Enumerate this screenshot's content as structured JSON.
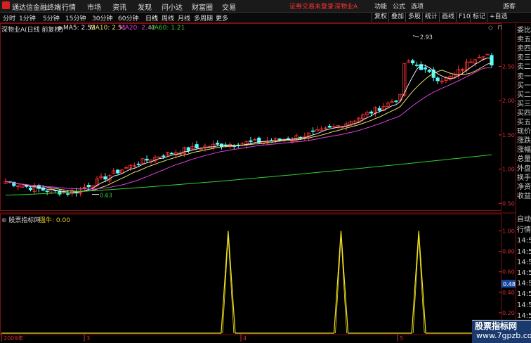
{
  "app": {
    "title": "通达信金融终端",
    "menu": [
      "行情",
      "市场",
      "资讯",
      "发现",
      "问小达",
      "财富圈",
      "交易"
    ],
    "login_warning": "证券交易未登录",
    "stock_name": "深物业A",
    "right_menu": [
      "功能",
      "公式",
      "选项"
    ],
    "guest": "游客"
  },
  "toolbar": {
    "periods": [
      "分时",
      "1分钟",
      "5分钟",
      "15分钟",
      "30分钟",
      "60分钟",
      "日线",
      "周线",
      "月线",
      "多周期",
      "更多"
    ],
    "active_period": "日线",
    "right_buttons": [
      "复权",
      "叠加",
      "多股",
      "统计",
      "画线",
      "F10",
      "标记",
      "+自选"
    ]
  },
  "main_chart": {
    "title": "深物业A(日线 前复权)",
    "ma": [
      {
        "label": "MA5: 2.52",
        "color": "#e8e8e8"
      },
      {
        "label": "MA10: 2.51",
        "color": "#e8e070"
      },
      {
        "label": "MA20: 2.42",
        "color": "#e040e0"
      },
      {
        "label": "MA60: 1.21",
        "color": "#30d030"
      }
    ],
    "high_label": "2.93",
    "low_label": "0.63",
    "y_ticks": [
      "2.50",
      "2.00",
      "1.50",
      "1.00",
      "0.50"
    ]
  },
  "sub_chart": {
    "title": "股票指标网",
    "indicator_label": "强牛: 0.00",
    "y_ticks": [
      "1.00",
      "0.80",
      "0.60",
      "0.40",
      "0.20"
    ],
    "current_value": "0.48",
    "x_labels": [
      "2009年",
      "3",
      "4",
      "5"
    ]
  },
  "right_panel": {
    "labels": [
      "委比",
      "卖五",
      "卖四",
      "卖三",
      "卖二",
      "卖一",
      "买一",
      "买二",
      "买三",
      "买四",
      "买五",
      "现价",
      "涨跌",
      "涨幅",
      "总量",
      "外盘",
      "换手",
      "净资",
      "收益"
    ],
    "lower_labels": [
      "自动",
      "行情",
      "14:5",
      "14:5",
      "14:5",
      "14:5",
      "14:5",
      "14:5",
      "14:5",
      "14:5",
      "14:5"
    ]
  },
  "watermark": {
    "line1": "股票指标网",
    "line2": "www.7gpzb.com"
  },
  "chart_data": [
    {
      "type": "candlestick",
      "title": "深物业A(日线 前复权)",
      "series_names": [
        "MA5",
        "MA10",
        "MA20",
        "MA60"
      ],
      "ylim": [
        0.4,
        3.05
      ],
      "close_start": 0.8,
      "close_end": 2.52,
      "high": 2.93,
      "low": 0.63
    },
    {
      "type": "line",
      "title": "强牛",
      "ylim": [
        0,
        1.1
      ],
      "spikes_at_fraction": [
        0.455,
        0.68,
        0.835
      ],
      "spike_value": 1.0,
      "baseline": 0.0
    }
  ]
}
